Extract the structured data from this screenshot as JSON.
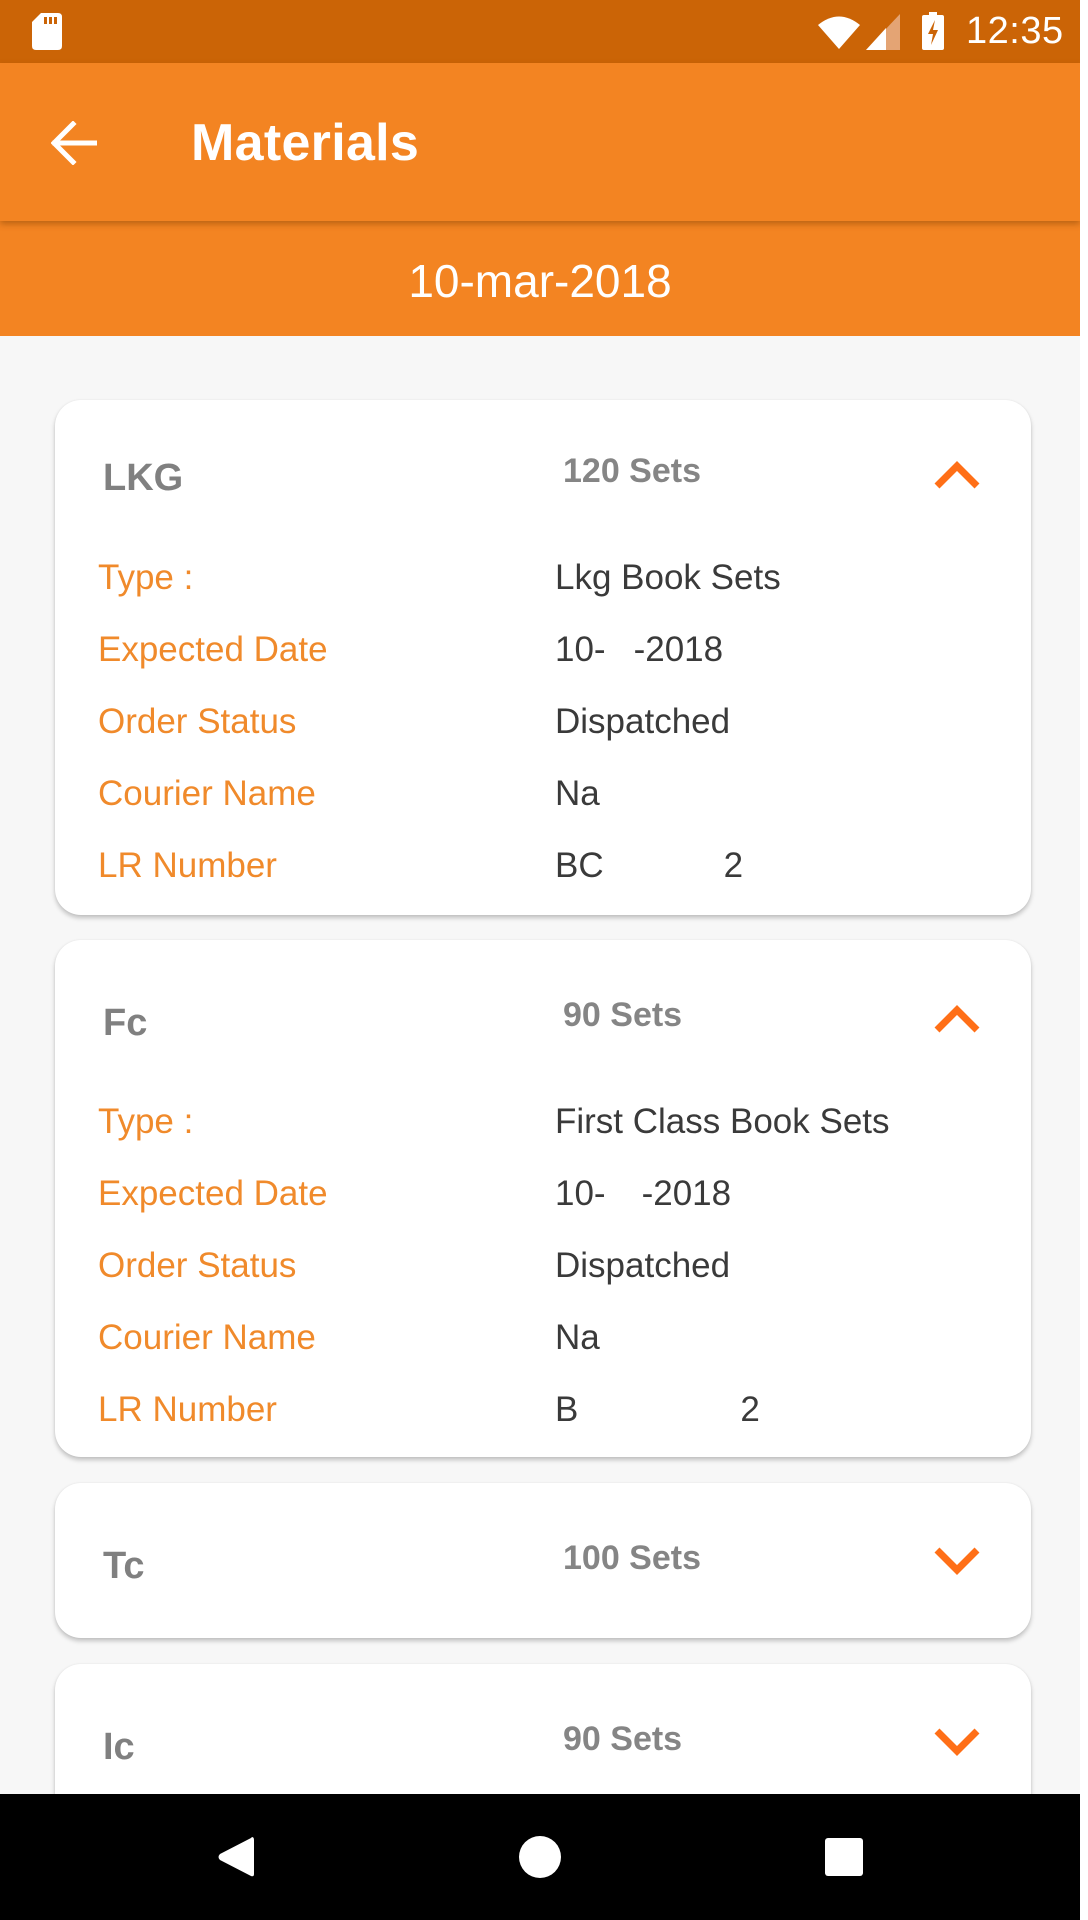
{
  "status_bar": {
    "time": "12:35",
    "icons": [
      "sd-card-icon",
      "wifi-icon",
      "cell-signal-icon",
      "battery-charging-icon"
    ]
  },
  "app_bar": {
    "back_icon": "arrow-left-icon",
    "title": "Materials"
  },
  "date_header": "10-mar-2018",
  "colors": {
    "status_bar": "#cb6406",
    "primary": "#f38422",
    "label": "#f08a2b",
    "chevron": "#ff6f17",
    "title_gray": "#808080",
    "value_text": "#3a3a3a",
    "background": "#f7f7f7"
  },
  "cards": [
    {
      "title": "LKG",
      "count": "120 Sets",
      "expanded": true,
      "chevron_icon": "chevron-up-icon",
      "details": [
        {
          "label": "Type :",
          "value": "Lkg Book Sets"
        },
        {
          "label": "Expected Date",
          "value_start": "10-",
          "value_end": "-2018"
        },
        {
          "label": "Order Status",
          "value": "Dispatched"
        },
        {
          "label": "Courier Name",
          "value_start": "Na",
          "value_end": ""
        },
        {
          "label": "LR Number",
          "value_start": "BC",
          "value_end": "2"
        }
      ]
    },
    {
      "title": "Fc",
      "count": "90 Sets",
      "expanded": true,
      "chevron_icon": "chevron-up-icon",
      "details": [
        {
          "label": "Type :",
          "value": "First Class Book Sets"
        },
        {
          "label": "Expected Date",
          "value_start": "10-",
          "value_end": "-2018"
        },
        {
          "label": "Order Status",
          "value": "Dispatched"
        },
        {
          "label": "Courier Name",
          "value_start": "Na",
          "value_end": ""
        },
        {
          "label": "LR Number",
          "value_start": "B",
          "value_end": "2"
        }
      ]
    },
    {
      "title": "Tc",
      "count": "100 Sets",
      "expanded": false,
      "chevron_icon": "chevron-down-icon"
    },
    {
      "title": "Ic",
      "count": "90 Sets",
      "expanded": false,
      "chevron_icon": "chevron-down-icon"
    }
  ],
  "nav_bar": {
    "buttons": [
      "back-triangle-icon",
      "home-circle-icon",
      "recents-square-icon"
    ]
  }
}
